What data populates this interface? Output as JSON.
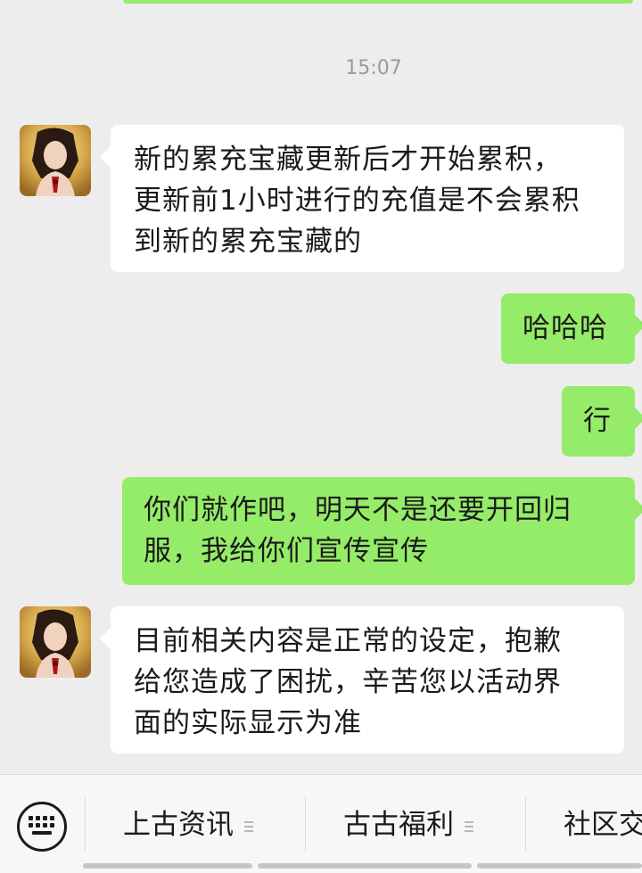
{
  "chat": {
    "timestamp": "15:07",
    "messages": [
      {
        "side": "left",
        "lines": [
          "新的累充宝藏更新后才开始累积，",
          "更新前1小时进行的充值是不会累积",
          "到新的累充宝藏的"
        ]
      },
      {
        "side": "right",
        "lines": [
          "哈哈哈"
        ]
      },
      {
        "side": "right",
        "lines": [
          "行"
        ]
      },
      {
        "side": "right",
        "lines": [
          "你们就作吧，明天不是还要开回归",
          "服，我给你们宣传宣传"
        ]
      },
      {
        "side": "left",
        "lines": [
          "目前相关内容是正常的设定，抱歉",
          "给您造成了困扰，辛苦您以活动界",
          "面的实际显示为准"
        ]
      }
    ]
  },
  "menu": {
    "keyboard_icon": "keyboard-icon",
    "items": [
      {
        "label": "上古资讯"
      },
      {
        "label": "古古福利"
      },
      {
        "label": "社区交"
      }
    ]
  },
  "colors": {
    "background": "#ededed",
    "outgoing_bubble": "#95ec69",
    "incoming_bubble": "#ffffff",
    "timestamp": "#9a9a9a"
  }
}
